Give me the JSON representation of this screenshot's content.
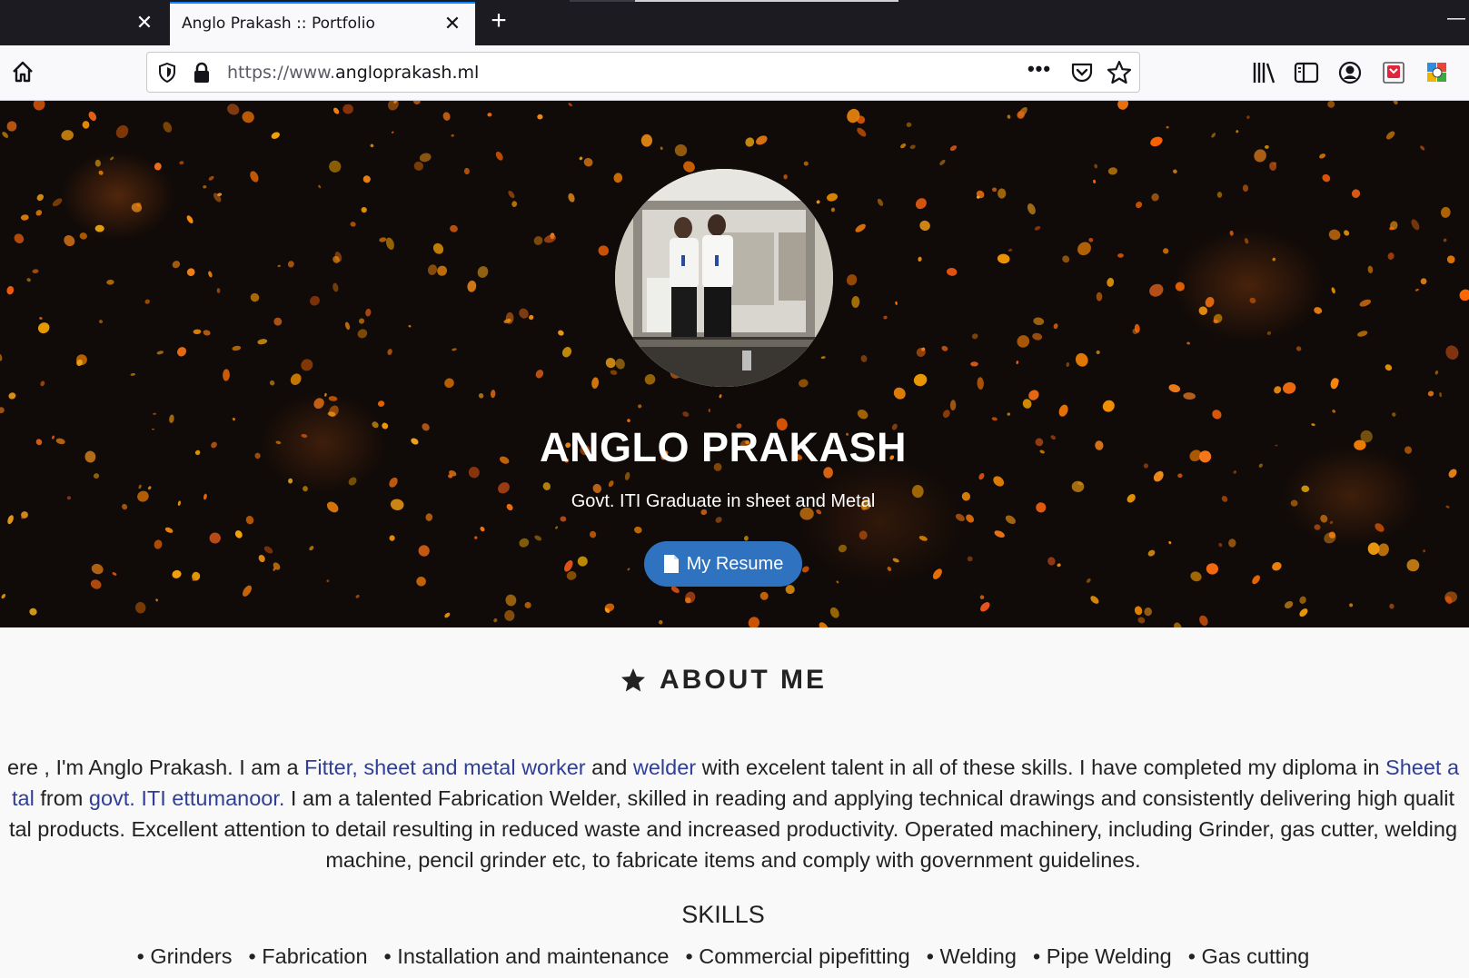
{
  "browser": {
    "tabs": [
      {
        "title": "Anglo Prakash :: Portfolio",
        "active": true
      }
    ],
    "url_protocol": "https://www.",
    "url_domain": "angloprakash.ml",
    "icons": {
      "home": "home-icon",
      "shield": "tracking-protection-shield-icon",
      "lock": "lock-icon",
      "more": "page-actions-more-icon",
      "pocket": "pocket-icon",
      "bookmark": "star-bookmark-icon",
      "library": "library-icon",
      "sidebar": "sidebar-icon",
      "account": "account-icon",
      "ext1": "extension-red-icon",
      "ext2": "extension-multicolor-icon"
    },
    "colors": {
      "tab_accent": "#0a84ff",
      "tabstrip_bg": "#1c1b22"
    }
  },
  "hero": {
    "name": "ANGLO PRAKASH",
    "subtitle": "Govt. ITI Graduate in sheet and Metal",
    "resume_button": "My Resume",
    "button_color": "#2f73c0"
  },
  "about": {
    "title": "ABOUT ME",
    "lines": [
      [
        {
          "text": "ere , I'm Anglo Prakash. I am a "
        },
        {
          "text": "Fitter, sheet and metal worker",
          "link": true
        },
        {
          "text": " and "
        },
        {
          "text": "welder",
          "link": true
        },
        {
          "text": " with excelent talent in all of these skills. I have completed my diploma in "
        },
        {
          "text": "Sheet a",
          "link": true
        }
      ],
      [
        {
          "text": "tal",
          "link": true
        },
        {
          "text": " from "
        },
        {
          "text": "govt. ITI ettumanoor.",
          "link": true
        },
        {
          "text": " I am a talented Fabrication Welder, skilled in reading and applying technical drawings and consistently delivering high qualit"
        }
      ],
      [
        {
          "text": "tal products. Excellent attention to detail resulting in reduced waste and increased productivity. Operated machinery, including Grinder, gas cutter, welding"
        }
      ],
      [
        {
          "text": "machine, pencil grinder etc, to fabricate items and comply with government guidelines."
        }
      ]
    ],
    "link_color": "#2f3f98"
  },
  "skills": {
    "title": "SKILLS",
    "items": [
      "• Grinders",
      "• Fabrication",
      "• Installation and maintenance",
      "• Commercial pipefitting",
      "• Welding",
      "• Pipe Welding",
      "• Gas cutting"
    ]
  }
}
